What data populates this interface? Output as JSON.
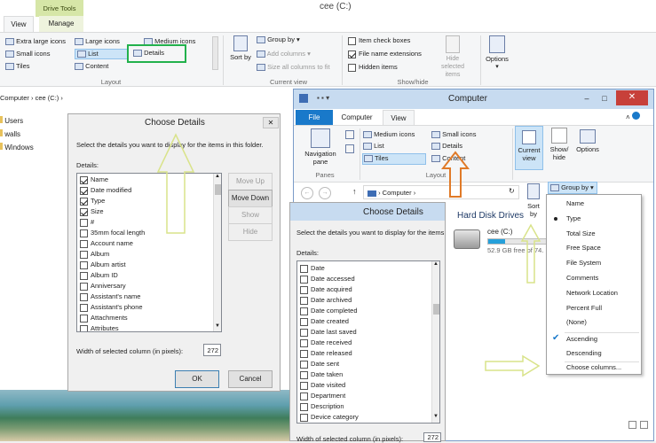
{
  "back_window": {
    "title": "cee (C:)",
    "context_tab": "Drive Tools",
    "tabs": [
      "View",
      "Manage"
    ],
    "layout_items": {
      "extra_large": "Extra large icons",
      "large": "Large icons",
      "medium": "Medium icons",
      "small": "Small icons",
      "list": "List",
      "details": "Details",
      "tiles": "Tiles",
      "content": "Content"
    },
    "layout_group": "Layout",
    "sort_by": "Sort by",
    "group_by": "Group by",
    "add_columns": "Add columns",
    "size_all": "Size all columns to fit",
    "current_view_group": "Current view",
    "item_check_boxes": "Item check boxes",
    "file_name_extensions": "File name extensions",
    "hidden_items": "Hidden items",
    "hide_selected": "Hide selected items",
    "options": "Options",
    "showhide_group": "Show/hide",
    "breadcrumb": [
      "Computer",
      "cee (C:)"
    ],
    "nav_items": [
      "Users",
      "walls",
      "Windows"
    ]
  },
  "choose_details_1": {
    "title": "Choose Details",
    "description": "Select the details you want to display for the items in this folder.",
    "details_label": "Details:",
    "items": [
      {
        "label": "Name",
        "checked": true
      },
      {
        "label": "Date modified",
        "checked": true
      },
      {
        "label": "Type",
        "checked": true
      },
      {
        "label": "Size",
        "checked": true
      },
      {
        "label": "#",
        "checked": false
      },
      {
        "label": "35mm focal length",
        "checked": false
      },
      {
        "label": "Account name",
        "checked": false
      },
      {
        "label": "Album",
        "checked": false
      },
      {
        "label": "Album artist",
        "checked": false
      },
      {
        "label": "Album ID",
        "checked": false
      },
      {
        "label": "Anniversary",
        "checked": false
      },
      {
        "label": "Assistant's name",
        "checked": false
      },
      {
        "label": "Assistant's phone",
        "checked": false
      },
      {
        "label": "Attachments",
        "checked": false
      },
      {
        "label": "Attributes",
        "checked": false
      }
    ],
    "move_up": "Move Up",
    "move_down": "Move Down",
    "show": "Show",
    "hide": "Hide",
    "width_label": "Width of selected column (in pixels):",
    "width_value": "272",
    "ok": "OK",
    "cancel": "Cancel",
    "close_glyph": "✕"
  },
  "computer_window": {
    "title": "Computer",
    "tabs": [
      "File",
      "Computer",
      "View"
    ],
    "nav_pane": "Navigation pane",
    "panes_group": "Panes",
    "layout_items": {
      "medium": "Medium icons",
      "small": "Small icons",
      "list": "List",
      "details": "Details",
      "tiles": "Tiles",
      "content": "Content"
    },
    "layout_group": "Layout",
    "current_view": "Current view",
    "show_hide": "Show/ hide",
    "options": "Options",
    "address": "Computer",
    "group_by": "Group by",
    "sort_by": "Sort by",
    "section_title": "Hard Disk Drives",
    "drive_name": "cee (C:)",
    "drive_free": "52.9 GB free of 74.",
    "drive_fill": 0.29
  },
  "group_menu": {
    "items": [
      "Name",
      "Type",
      "Total Size",
      "Free Space",
      "File System",
      "Comments",
      "Network Location",
      "Percent Full",
      "(None)"
    ],
    "bullet_index": 1,
    "order": [
      "Ascending",
      "Descending"
    ],
    "checked_order": 0,
    "choose": "Choose columns..."
  },
  "choose_details_2": {
    "title": "Choose Details",
    "description": "Select the details you want to display for the items",
    "details_label": "Details:",
    "items": [
      {
        "label": "Date",
        "checked": false
      },
      {
        "label": "Date accessed",
        "checked": false
      },
      {
        "label": "Date acquired",
        "checked": false
      },
      {
        "label": "Date archived",
        "checked": false
      },
      {
        "label": "Date completed",
        "checked": false
      },
      {
        "label": "Date created",
        "checked": false
      },
      {
        "label": "Date last saved",
        "checked": false
      },
      {
        "label": "Date received",
        "checked": false
      },
      {
        "label": "Date released",
        "checked": false
      },
      {
        "label": "Date sent",
        "checked": false
      },
      {
        "label": "Date taken",
        "checked": false
      },
      {
        "label": "Date visited",
        "checked": false
      },
      {
        "label": "Department",
        "checked": false
      },
      {
        "label": "Description",
        "checked": false
      },
      {
        "label": "Device category",
        "checked": false
      }
    ],
    "width_label": "Width of selected column (in pixels):",
    "width_value": "272"
  },
  "colors": {
    "accent_blue": "#1979ca",
    "context_tab": "#d6e6a7",
    "highlight_green": "#22b14c",
    "arrow_yellow": "#d9e38a",
    "arrow_orange": "#e07a28",
    "close_red": "#c7403a",
    "selection": "#cce4f7"
  }
}
